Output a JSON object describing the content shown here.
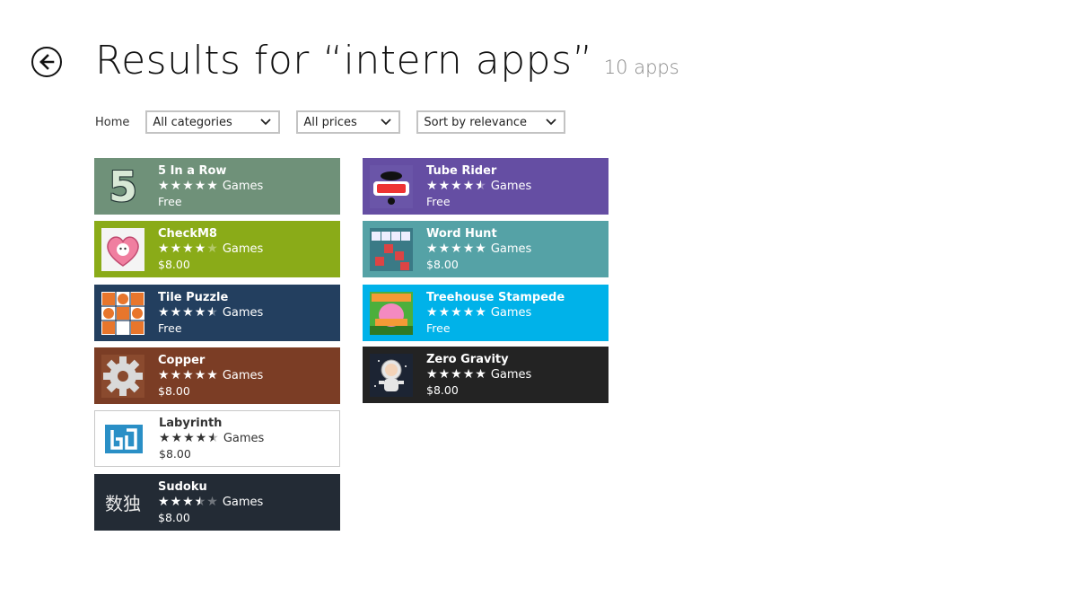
{
  "header": {
    "title": "Results for “intern apps”",
    "count": "10 apps"
  },
  "filters": {
    "home": "Home",
    "category": "All categories",
    "price": "All prices",
    "sort": "Sort by relevance"
  },
  "colors": {
    "five_in_a_row": "#6f9179",
    "tube_rider": "#654ea3",
    "checkm8": "#8aab18",
    "word_hunt": "#55a2a6",
    "tile_puzzle": "#233f5f",
    "treehouse_stampede": "#00b2e9",
    "copper": "#7b3d25",
    "zero_gravity": "#232323",
    "labyrinth": "#ffffff",
    "sudoku": "#232b35"
  },
  "apps": [
    {
      "name": "5 In a Row",
      "rating": 5,
      "category": "Games",
      "price": "Free",
      "icon": "green-five-icon"
    },
    {
      "name": "Tube Rider",
      "rating": 4.5,
      "category": "Games",
      "price": "Free",
      "icon": "tube-rider-logo-icon"
    },
    {
      "name": "CheckM8",
      "rating": 4,
      "category": "Games",
      "price": "$8.00",
      "icon": "pink-heart-icon"
    },
    {
      "name": "Word Hunt",
      "rating": 5,
      "category": "Games",
      "price": "$8.00",
      "icon": "letter-tiles-icon"
    },
    {
      "name": "Tile Puzzle",
      "rating": 4.5,
      "category": "Games",
      "price": "Free",
      "icon": "orange-tiles-icon"
    },
    {
      "name": "Treehouse Stampede",
      "rating": 5,
      "category": "Games",
      "price": "Free",
      "icon": "treehouse-icon"
    },
    {
      "name": "Copper",
      "rating": 5,
      "category": "Games",
      "price": "$8.00",
      "icon": "gear-icon"
    },
    {
      "name": "Zero Gravity",
      "rating": 5,
      "category": "Games",
      "price": "$8.00",
      "icon": "astronaut-icon"
    },
    {
      "name": "Labyrinth",
      "rating": 4.5,
      "category": "Games",
      "price": "$8.00",
      "icon": "maze-icon"
    },
    {
      "name": "Sudoku",
      "rating": 3.5,
      "category": "Games",
      "price": "$8.00",
      "icon": "kanji-sudoku-icon"
    }
  ],
  "sudoku_icon_text": "数独",
  "five_icon_text": "5"
}
